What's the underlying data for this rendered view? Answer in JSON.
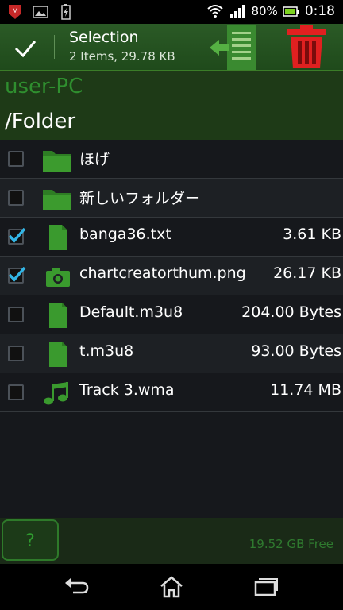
{
  "status_bar": {
    "battery_percent": "80%",
    "time": "0:18",
    "left_icons": [
      "mcafee-icon",
      "image-icon",
      "battery-charging-icon"
    ],
    "right_icons": [
      "wifi-icon",
      "signal-icon",
      "battery-icon"
    ]
  },
  "action_bar": {
    "title": "Selection",
    "subtitle": "2 Items, 29.78 KB",
    "icons": [
      "checkmark-icon",
      "move-icon",
      "trash-icon"
    ]
  },
  "location": {
    "host": "user-PC",
    "path": "/Folder"
  },
  "files": [
    {
      "name": "ほげ",
      "size": "",
      "type": "folder",
      "checked": false
    },
    {
      "name": "新しいフォルダー",
      "size": "",
      "type": "folder",
      "checked": false
    },
    {
      "name": "banga36.txt",
      "size": "3.61 KB",
      "type": "file",
      "checked": true
    },
    {
      "name": "chartcreatorthum.png",
      "size": "26.17 KB",
      "type": "image",
      "checked": true
    },
    {
      "name": "Default.m3u8",
      "size": "204.00 Bytes",
      "type": "file",
      "checked": false
    },
    {
      "name": "t.m3u8",
      "size": "93.00 Bytes",
      "type": "file",
      "checked": false
    },
    {
      "name": "Track 3.wma",
      "size": "11.74 MB",
      "type": "music",
      "checked": false
    }
  ],
  "bottom": {
    "help_label": "?",
    "free_space": "19.52 GB Free"
  },
  "colors": {
    "accent_green": "#2f8f2f",
    "action_bar": "#2b5a26",
    "check_blue": "#33b5e5",
    "trash_red": "#e02020"
  }
}
